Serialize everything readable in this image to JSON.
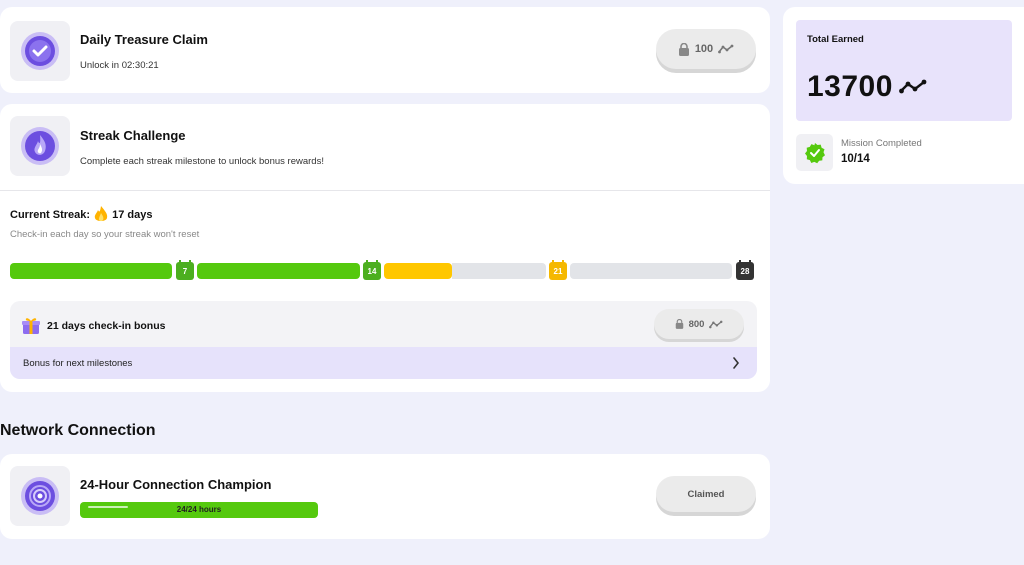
{
  "daily": {
    "title": "Daily Treasure Claim",
    "subtitle": "Unlock in 02:30:21",
    "reward": "100"
  },
  "streak": {
    "title": "Streak Challenge",
    "subtitle": "Complete each streak milestone to unlock bonus rewards!",
    "current_label": "Current Streak:",
    "current_value": "17 days",
    "hint": "Check-in each day so your streak won't reset",
    "current_days": 17,
    "total_days": 28,
    "milestones": [
      {
        "label": "7",
        "color": "#4caf1f"
      },
      {
        "label": "14",
        "color": "#4caf1f"
      },
      {
        "label": "21",
        "color": "#f5b800"
      },
      {
        "label": "28",
        "color": "#333333"
      }
    ],
    "colors": {
      "done": "#55c90e",
      "current": "#ffc700",
      "remaining": "#e2e4e8"
    }
  },
  "bonus": {
    "title": "21 days check-in bonus",
    "reward": "800",
    "next_label": "Bonus for next milestones"
  },
  "network": {
    "section_title": "Network Connection",
    "task_title": "24-Hour Connection Champion",
    "progress_text": "24/24 hours",
    "progress_fraction": 1.0,
    "status_label": "Claimed"
  },
  "summary": {
    "total_label": "Total Earned",
    "total_value": "13700",
    "mission_label": "Mission Completed",
    "mission_value": "10/14"
  },
  "colors": {
    "accent_purple": "#6c4ee0",
    "summary_bg": "#e8e3fb",
    "green": "#55c90e"
  }
}
